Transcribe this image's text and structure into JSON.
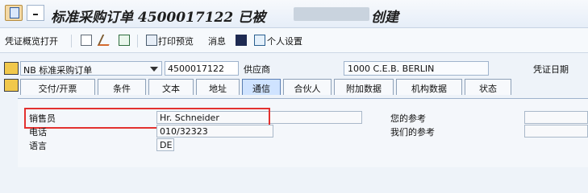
{
  "title": {
    "prefix": "标准采购订单 4500017122 已被",
    "suffix": "创建"
  },
  "toolbar": {
    "doc_overview": "凭证概览打开",
    "print_preview": "打印预览",
    "messages": "消息",
    "personal_settings": "个人设置"
  },
  "header": {
    "order_type": "NB 标准采购订单",
    "order_number": "4500017122",
    "vendor_label": "供应商",
    "vendor_value": "1000 C.E.B. BERLIN",
    "doc_date_label": "凭证日期"
  },
  "tabs": [
    {
      "label": "交付/开票"
    },
    {
      "label": "条件"
    },
    {
      "label": "文本"
    },
    {
      "label": "地址"
    },
    {
      "label": "通信"
    },
    {
      "label": "合伙人"
    },
    {
      "label": "附加数据"
    },
    {
      "label": "机构数据"
    },
    {
      "label": "状态"
    }
  ],
  "communication": {
    "salesperson_label": "销售员",
    "salesperson_value": "Hr. Schneider",
    "phone_label": "电话",
    "phone_value": "010/32323",
    "language_label": "语言",
    "language_value": "DE",
    "your_ref_label": "您的参考",
    "our_ref_label": "我们的参考"
  }
}
